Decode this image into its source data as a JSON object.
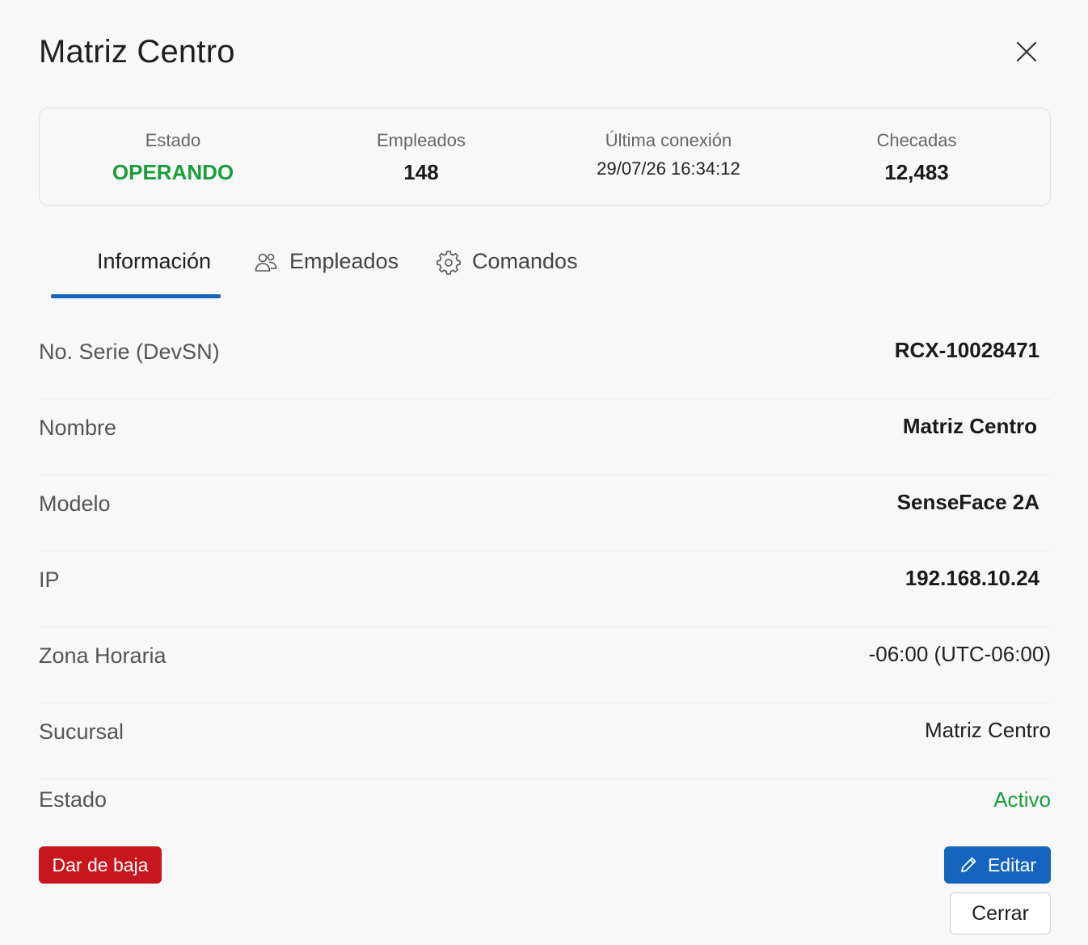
{
  "modal": {
    "title": "Matriz Centro"
  },
  "summary": {
    "estado_label": "Estado",
    "estado_value": "OPERANDO",
    "empleados_label": "Empleados",
    "empleados_value": "148",
    "conexion_label": "Última conexión",
    "conexion_value": "29/07/26 16:34:12",
    "checadas_label": "Checadas",
    "checadas_value": "12,483"
  },
  "tabs": [
    {
      "label": "Información",
      "icon": "none",
      "active": true
    },
    {
      "label": "Empleados",
      "icon": "users-icon",
      "active": false
    },
    {
      "label": "Comandos",
      "icon": "gear-icon",
      "active": false
    }
  ],
  "details": [
    {
      "key": "No. Serie (DevSN)",
      "value": "RCX-10028471"
    },
    {
      "key": "Nombre",
      "value": "Matriz Centro"
    },
    {
      "key": "Modelo",
      "value": "SenseFace 2A"
    },
    {
      "key": "IP",
      "value": "192.168.10.24"
    },
    {
      "key": "Zona Horaria",
      "value": "-06:00 (UTC-06:00)"
    },
    {
      "key": "Sucursal",
      "value": "Matriz Centro"
    },
    {
      "key": "Estado",
      "value": "Activo"
    }
  ],
  "actions": {
    "deactivate_label": "Dar de baja",
    "edit_label": "Editar",
    "close_label": "Cerrar"
  },
  "colors": {
    "primary": "#1565c0",
    "danger": "#c8161f",
    "success": "#1a9e3b"
  }
}
